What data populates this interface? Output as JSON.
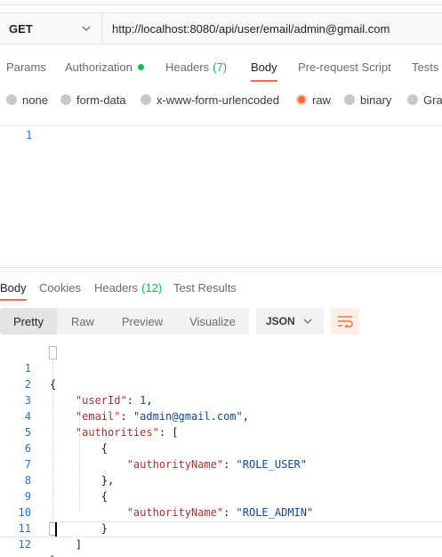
{
  "request": {
    "method": "GET",
    "url": "http://localhost:8080/api/user/email/admin@gmail.com"
  },
  "request_tabs": [
    {
      "label": "Params"
    },
    {
      "label": "Authorization"
    },
    {
      "label": "Headers",
      "count": "(7)"
    },
    {
      "label": "Body",
      "active": true
    },
    {
      "label": "Pre-request Script"
    },
    {
      "label": "Tests"
    }
  ],
  "body_types": [
    {
      "label": "none"
    },
    {
      "label": "form-data"
    },
    {
      "label": "x-www-form-urlencoded"
    },
    {
      "label": "raw",
      "selected": true
    },
    {
      "label": "binary"
    },
    {
      "label": "Grap"
    }
  ],
  "request_editor": {
    "line_number": "1"
  },
  "response_tabs": [
    {
      "label": "Body",
      "active": true
    },
    {
      "label": "Cookies"
    },
    {
      "label": "Headers",
      "count": "(12)"
    },
    {
      "label": "Test Results"
    }
  ],
  "view_modes": [
    {
      "label": "Pretty",
      "active": true
    },
    {
      "label": "Raw"
    },
    {
      "label": "Preview"
    },
    {
      "label": "Visualize"
    }
  ],
  "format": {
    "label": "JSON"
  },
  "icons": {
    "method_chevron": "chevron-down-icon",
    "format_chevron": "chevron-down-icon",
    "wrap": "wrap-lines-icon"
  },
  "colors": {
    "accent": "#f26b3a",
    "status_green": "#0cbb52",
    "line_number": "#2a6cc4",
    "json_key": "#a1362e",
    "json_value": "#0b4aa2"
  },
  "response_body": {
    "line_numbers": [
      "1",
      "2",
      "3",
      "4",
      "5",
      "6",
      "7",
      "8",
      "9",
      "10",
      "11",
      "12"
    ],
    "lines": [
      "{",
      "    \"userId\": 1,",
      "    \"email\": \"admin@gmail.com\",",
      "    \"authorities\": [",
      "        {",
      "            \"authorityName\": \"ROLE_USER\"",
      "        },",
      "        {",
      "            \"authorityName\": \"ROLE_ADMIN\"",
      "        }",
      "    ]",
      "}"
    ],
    "tokens": {
      "open_brace": "{",
      "key_userId": "\"userId\"",
      "val_userId": "1",
      "key_email": "\"email\"",
      "val_email": "\"admin@gmail.com\"",
      "key_authorities": "\"authorities\"",
      "open_bracket": "[",
      "obj_open": "{",
      "key_authorityName": "\"authorityName\"",
      "val_role_user": "\"ROLE_USER\"",
      "obj_close_comma": "},",
      "val_role_admin": "\"ROLE_ADMIN\"",
      "obj_close": "}",
      "close_bracket": "]",
      "close_brace": "}",
      "colon": ": ",
      "comma": ","
    }
  }
}
